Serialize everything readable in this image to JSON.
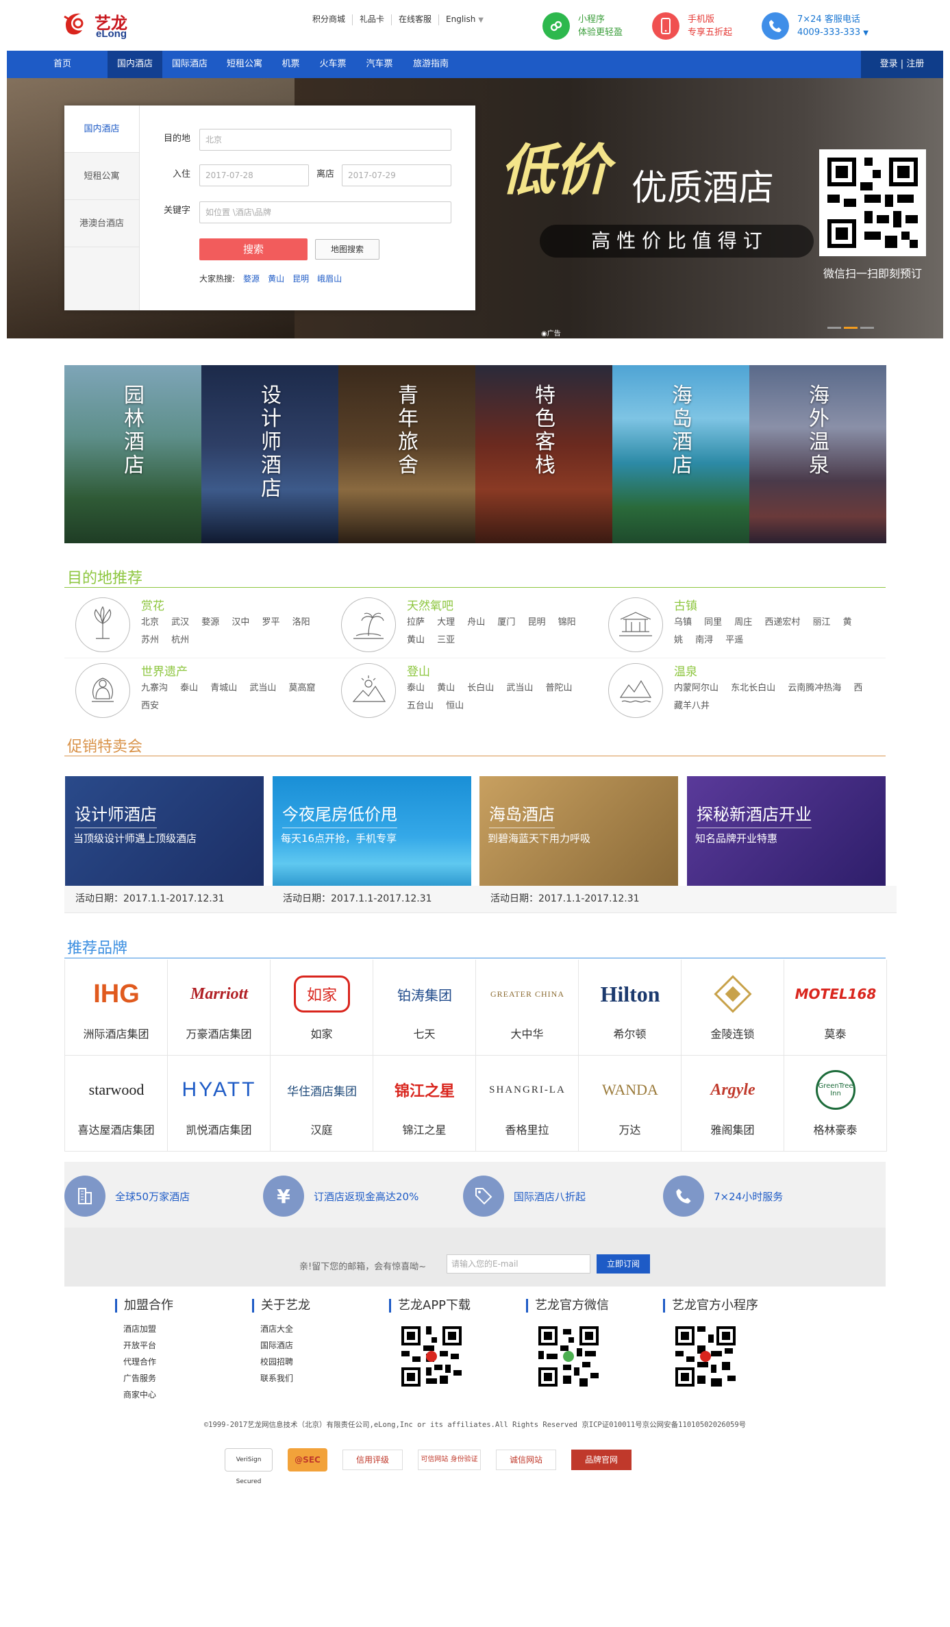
{
  "header": {
    "logo_cn": "艺龙",
    "logo_en": "eLong",
    "top_links": [
      "积分商城",
      "礼品卡",
      "在线客服",
      "English"
    ],
    "miniapp": {
      "line1": "小程序",
      "line2": "体验更轻盈"
    },
    "mobile": {
      "line1": "手机版",
      "line2": "专享五折起"
    },
    "service": {
      "line1": "7×24 客服电话",
      "line2": "4009-333-333"
    }
  },
  "nav": {
    "items": [
      "首页",
      "国内酒店",
      "国际酒店",
      "短租公寓",
      "机票",
      "火车票",
      "汽车票",
      "旅游指南"
    ],
    "login": "登录 | 注册"
  },
  "search": {
    "tabs": [
      "国内酒店",
      "短租公寓",
      "港澳台酒店"
    ],
    "dest_label": "目的地",
    "dest_value": "北京",
    "checkin_label": "入住",
    "checkin_value": "2017-07-28",
    "checkout_label": "离店",
    "checkout_value": "2017-07-29",
    "keyword_label": "关键字",
    "keyword_placeholder": "如位置 \\酒店\\品牌",
    "search_btn": "搜索",
    "map_btn": "地图搜索",
    "hot_label": "大家热搜:",
    "hot_items": [
      "婺源",
      "黄山",
      "昆明",
      "峨眉山"
    ]
  },
  "banner": {
    "headline_a": "低价",
    "headline_b": "优质酒店",
    "subline": "高 性 价 比 值 得 订",
    "qr_caption": "微信扫一扫即刻预订",
    "ad_tag": "广告"
  },
  "categories": [
    {
      "title": "园林酒店",
      "color": "#3f6a54"
    },
    {
      "title": "设计师酒店",
      "color": "#22314f"
    },
    {
      "title": "青年旅舍",
      "color": "#4b3a28"
    },
    {
      "title": "特色客栈",
      "color": "#6b2a1f"
    },
    {
      "title": "海岛酒店",
      "color": "#2c6f8e"
    },
    {
      "title": "海外温泉",
      "color": "#3b3448"
    }
  ],
  "destinations": {
    "heading": "目的地推荐",
    "groups": [
      {
        "name": "赏花",
        "cities": "北京 武汉 婺源 汉中 罗平 洛阳 苏州 杭州"
      },
      {
        "name": "天然氧吧",
        "cities": "拉萨 大理 舟山 厦门 昆明 锦阳 黄山 三亚"
      },
      {
        "name": "古镇",
        "cities": "乌镇 同里 周庄 西递宏村 丽江 黄姚 南浔 平遥"
      },
      {
        "name": "世界遗产",
        "cities": "九寨沟 泰山 青城山 武当山 莫高窟 西安"
      },
      {
        "name": "登山",
        "cities": "泰山 黄山 长白山 武当山 普陀山 五台山 恒山"
      },
      {
        "name": "温泉",
        "cities": "内蒙阿尔山 东北长白山 云南腾冲热海 西藏羊八井"
      }
    ]
  },
  "promotions": {
    "heading": "促销特卖会",
    "items": [
      {
        "title": "设计师酒店",
        "sub": "当顶级设计师遇上顶级酒店",
        "date": "活动日期：2017.1.1-2017.12.31",
        "color": "#1f3a78"
      },
      {
        "title": "今夜尾房低价甩",
        "sub": "每天16点开抢，手机专享",
        "date": "活动日期：2017.1.1-2017.12.31",
        "color": "#1a8fd6"
      },
      {
        "title": "海岛酒店",
        "sub": "到碧海蓝天下用力呼吸",
        "date": "活动日期：2017.1.1-2017.12.31",
        "color": "#b08a4e"
      },
      {
        "title": "探秘新酒店开业",
        "sub": "知名品牌开业特惠",
        "date": "",
        "color": "#4a2a8a"
      }
    ]
  },
  "brands": {
    "heading": "推荐品牌",
    "items": [
      {
        "name": "洲际酒店集团",
        "logo": "IHG"
      },
      {
        "name": "万豪酒店集团",
        "logo": "Marriott"
      },
      {
        "name": "如家",
        "logo": "如家"
      },
      {
        "name": "七天",
        "logo": "铂涛集团"
      },
      {
        "name": "大中华",
        "logo": "GREATER CHINA"
      },
      {
        "name": "希尔顿",
        "logo": "Hilton"
      },
      {
        "name": "金陵连锁",
        "logo": "金陵"
      },
      {
        "name": "莫泰",
        "logo": "MOTEL168"
      },
      {
        "name": "喜达屋酒店集团",
        "logo": "starwood"
      },
      {
        "name": "凯悦酒店集团",
        "logo": "HYATT"
      },
      {
        "name": "汉庭",
        "logo": "华住酒店集团"
      },
      {
        "name": "锦江之星",
        "logo": "锦江之星"
      },
      {
        "name": "香格里拉",
        "logo": "SHANGRI-LA"
      },
      {
        "name": "万达",
        "logo": "WANDA"
      },
      {
        "name": "雅阁集团",
        "logo": "Argyle"
      },
      {
        "name": "格林豪泰",
        "logo": "GreenTree Inn"
      }
    ]
  },
  "features": {
    "items": [
      "全球50万家酒店",
      "订酒店返现金高达20%",
      "国际酒店八折起",
      "7×24小时服务"
    ],
    "subscribe_text": "亲!留下您的邮箱，会有惊喜呦~",
    "email_placeholder": "请输入您的E-mail",
    "subscribe_btn": "立即订阅"
  },
  "footer": {
    "col1": {
      "title": "加盟合作",
      "links": [
        "酒店加盟",
        "开放平台",
        "代理合作",
        "广告服务",
        "商家中心"
      ]
    },
    "col2": {
      "title": "关于艺龙",
      "links": [
        "酒店大全",
        "国际酒店",
        "校园招聘",
        "联系我们"
      ]
    },
    "col3": {
      "title": "艺龙APP下载"
    },
    "col4": {
      "title": "艺龙官方微信"
    },
    "col5": {
      "title": "艺龙官方小程序"
    },
    "copyright": "©1999-2017艺龙网信息技术（北京）有限责任公司,eLong,Inc or its affiliates.All Rights Reserved 京ICP证010011号京公网安备11010502026059号",
    "badges": [
      "VeriSign Secured",
      "@SEC",
      "信用评级",
      "可信网站 身份验证",
      "诚信网站",
      "品牌官网"
    ]
  }
}
